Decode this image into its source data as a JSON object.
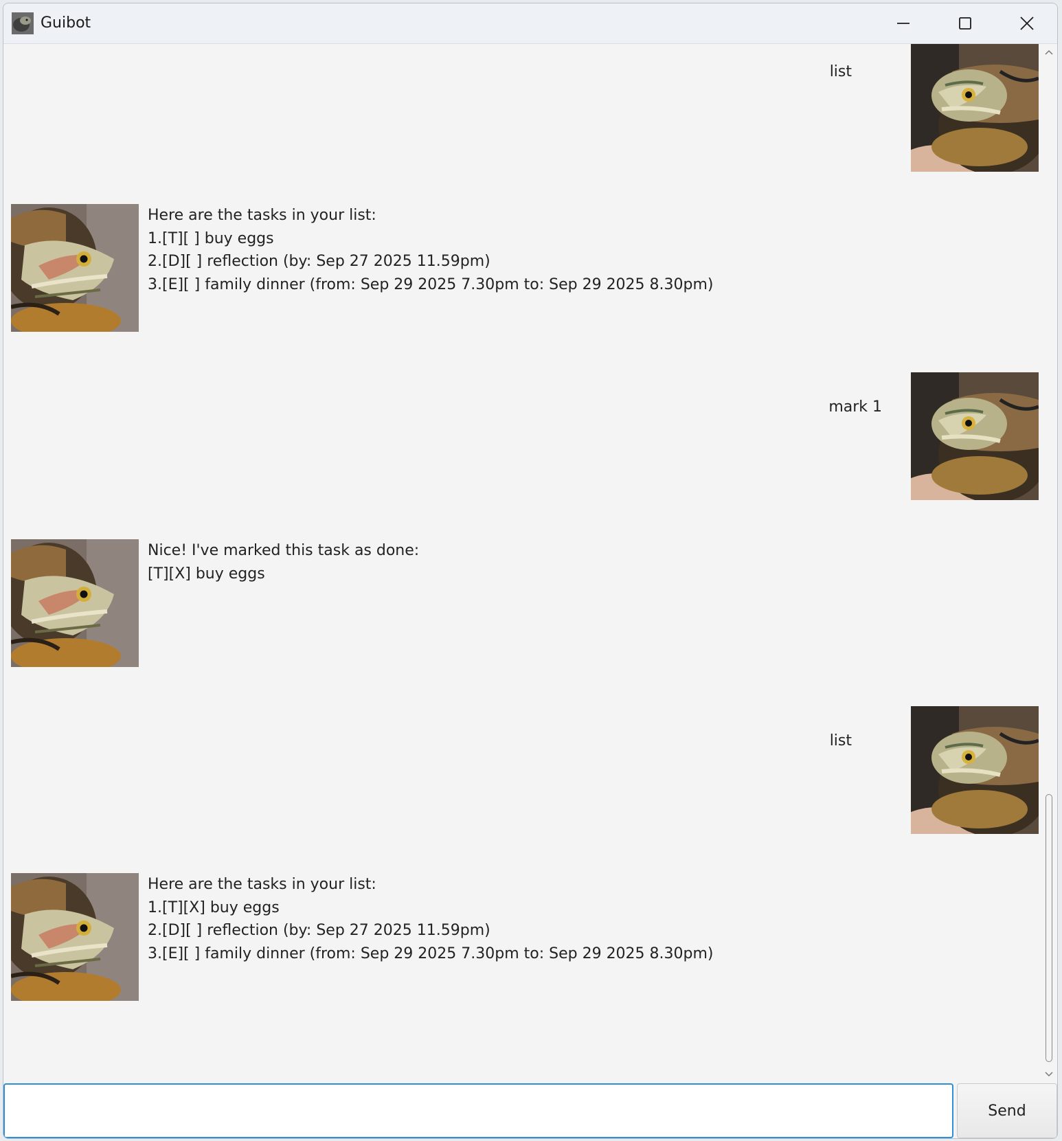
{
  "window": {
    "title": "Guibot"
  },
  "messages": [
    {
      "role": "user",
      "lines": [
        "list"
      ]
    },
    {
      "role": "bot",
      "lines": [
        "Here are the tasks in your list:",
        "1.[T][ ] buy eggs",
        "2.[D][ ] reflection (by: Sep 27 2025 11.59pm)",
        "3.[E][ ] family dinner (from: Sep 29 2025 7.30pm to: Sep 29 2025 8.30pm)"
      ]
    },
    {
      "role": "user",
      "lines": [
        "mark 1"
      ]
    },
    {
      "role": "bot",
      "lines": [
        "Nice! I've marked this task as done:",
        "[T][X] buy eggs"
      ]
    },
    {
      "role": "user",
      "lines": [
        "list"
      ]
    },
    {
      "role": "bot",
      "lines": [
        "Here are the tasks in your list:",
        "1.[T][X] buy eggs",
        "2.[D][ ] reflection (by: Sep 27 2025 11.59pm)",
        "3.[E][ ] family dinner (from: Sep 29 2025 7.30pm to: Sep 29 2025 8.30pm)"
      ]
    }
  ],
  "input": {
    "value": "",
    "placeholder": ""
  },
  "send_button": {
    "label": "Send"
  },
  "colors": {
    "input_focus_border": "#2f8fd6",
    "chat_background": "#f4f4f4"
  }
}
